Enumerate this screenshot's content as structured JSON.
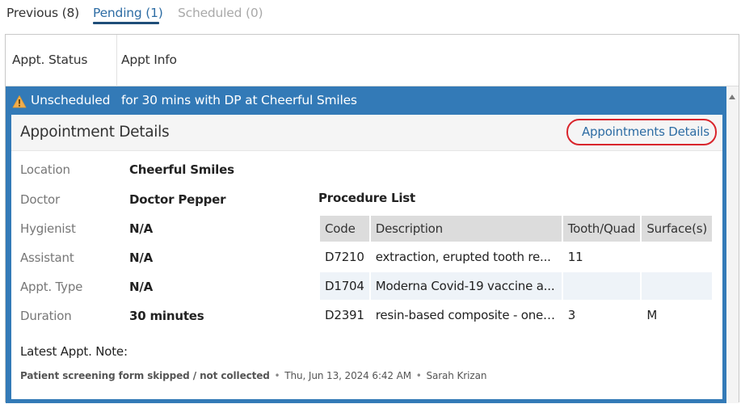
{
  "tabs": {
    "previous": "Previous (8)",
    "pending": "Pending (1)",
    "scheduled": "Scheduled (0)"
  },
  "columns": {
    "status": "Appt. Status",
    "info": "Appt Info"
  },
  "appointment": {
    "status": "Unscheduled",
    "summary": "for 30 mins with DP at Cheerful Smiles"
  },
  "details": {
    "title": "Appointment Details",
    "link_label": "Appointments Details",
    "fields": [
      {
        "label": "Location",
        "value": "Cheerful Smiles"
      },
      {
        "label": "Doctor",
        "value": "Doctor Pepper"
      },
      {
        "label": "Hygienist",
        "value": "N/A"
      },
      {
        "label": "Assistant",
        "value": "N/A"
      },
      {
        "label": "Appt. Type",
        "value": "N/A"
      },
      {
        "label": "Duration",
        "value": "30 minutes"
      }
    ],
    "procedure_list_title": "Procedure List",
    "procedure_headers": [
      "Code",
      "Description",
      "Tooth/Quad",
      "Surface(s)"
    ],
    "procedures": [
      {
        "code": "D7210",
        "description": "extraction, erupted tooth re...",
        "tooth": "11",
        "surface": ""
      },
      {
        "code": "D1704",
        "description": "Moderna Covid-19 vaccine a...",
        "tooth": "",
        "surface": ""
      },
      {
        "code": "D2391",
        "description": "resin-based composite - one ...",
        "tooth": "3",
        "surface": "M"
      }
    ],
    "latest_note_label": "Latest Appt. Note:",
    "note": {
      "text": "Patient screening form skipped / not collected",
      "timestamp": "Thu, Jun 13, 2024 6:42 AM",
      "author": "Sarah Krizan",
      "separator": "•"
    }
  },
  "colors": {
    "accent": "#337ab7",
    "link": "#2e6da4",
    "highlight": "#d9252c",
    "warning": "#f0ad4e"
  }
}
